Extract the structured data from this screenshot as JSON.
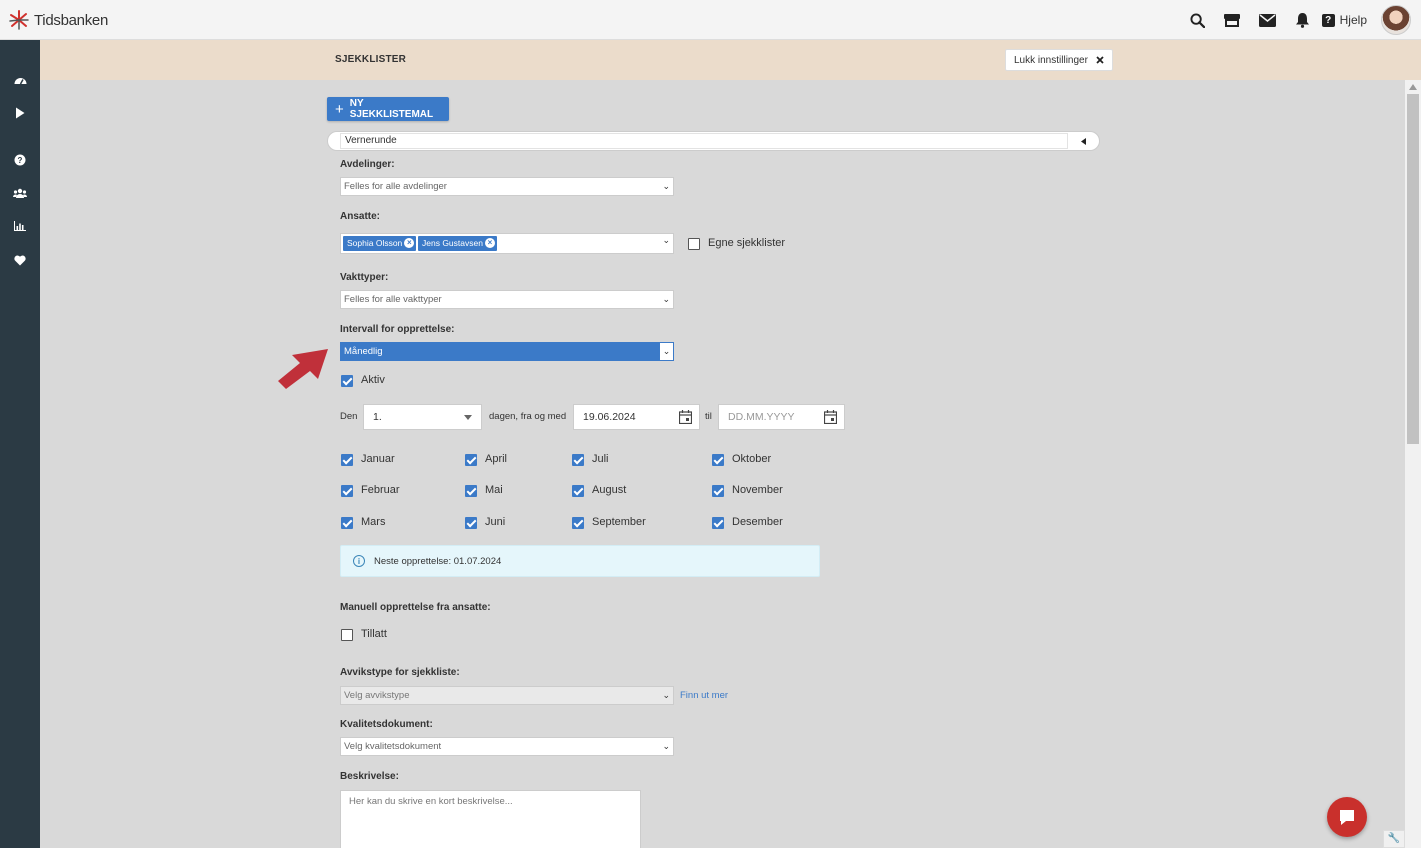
{
  "app": {
    "brand": "Tidsbanken"
  },
  "topbar": {
    "help_label": "Hjelp"
  },
  "header": {
    "title": "SJEKKLISTER",
    "close_label": "Lukk innstillinger"
  },
  "actions": {
    "new_template_label": "NY SJEKKLISTEMAL"
  },
  "template": {
    "name": "Vernerunde"
  },
  "form": {
    "departments_label": "Avdelinger:",
    "departments_value": "Felles for alle avdelinger",
    "employees_label": "Ansatte:",
    "employees": [
      "Sophia Olsson",
      "Jens Gustavsen"
    ],
    "own_checklists_label": "Egne sjekklister",
    "own_checklists_checked": false,
    "shift_types_label": "Vakttyper:",
    "shift_types_value": "Felles for alle vakttyper",
    "interval_label": "Intervall for opprettelse:",
    "interval_value": "Månedlig",
    "active_label": "Aktiv",
    "active_checked": true,
    "day_prefix": "Den",
    "day_value": "1.",
    "day_suffix": "dagen, fra og med",
    "from_date": "19.06.2024",
    "to_label": "til",
    "to_date_placeholder": "DD.MM.YYYY",
    "months": [
      {
        "label": "Januar",
        "checked": true
      },
      {
        "label": "Februar",
        "checked": true
      },
      {
        "label": "Mars",
        "checked": true
      },
      {
        "label": "April",
        "checked": true
      },
      {
        "label": "Mai",
        "checked": true
      },
      {
        "label": "Juni",
        "checked": true
      },
      {
        "label": "Juli",
        "checked": true
      },
      {
        "label": "August",
        "checked": true
      },
      {
        "label": "September",
        "checked": true
      },
      {
        "label": "Oktober",
        "checked": true
      },
      {
        "label": "November",
        "checked": true
      },
      {
        "label": "Desember",
        "checked": true
      }
    ],
    "next_creation_text": "Neste opprettelse: 01.07.2024",
    "manual_label": "Manuell opprettelse fra ansatte:",
    "manual_allowed_label": "Tillatt",
    "manual_allowed_checked": false,
    "deviation_label": "Avvikstype for sjekkliste:",
    "deviation_placeholder": "Velg avvikstype",
    "find_more_label": "Finn ut mer",
    "quality_doc_label": "Kvalitetsdokument:",
    "quality_doc_placeholder": "Velg kvalitetsdokument",
    "description_label": "Beskrivelse:",
    "description_placeholder": "Her kan du skrive en kort beskrivelse..."
  },
  "colors": {
    "accent": "#3b7ac8",
    "sidebar": "#2b3a44",
    "header_band": "#ebdccb",
    "annotation_arrow": "#c0303a",
    "chat": "#c9302c"
  },
  "icons": {
    "topbar": [
      "search-icon",
      "store-icon",
      "mail-icon",
      "bell-icon",
      "help-icon"
    ],
    "sidebar": [
      "dashboard-icon",
      "play-icon",
      "help-circle-icon",
      "users-icon",
      "chart-icon",
      "heart-icon"
    ]
  }
}
